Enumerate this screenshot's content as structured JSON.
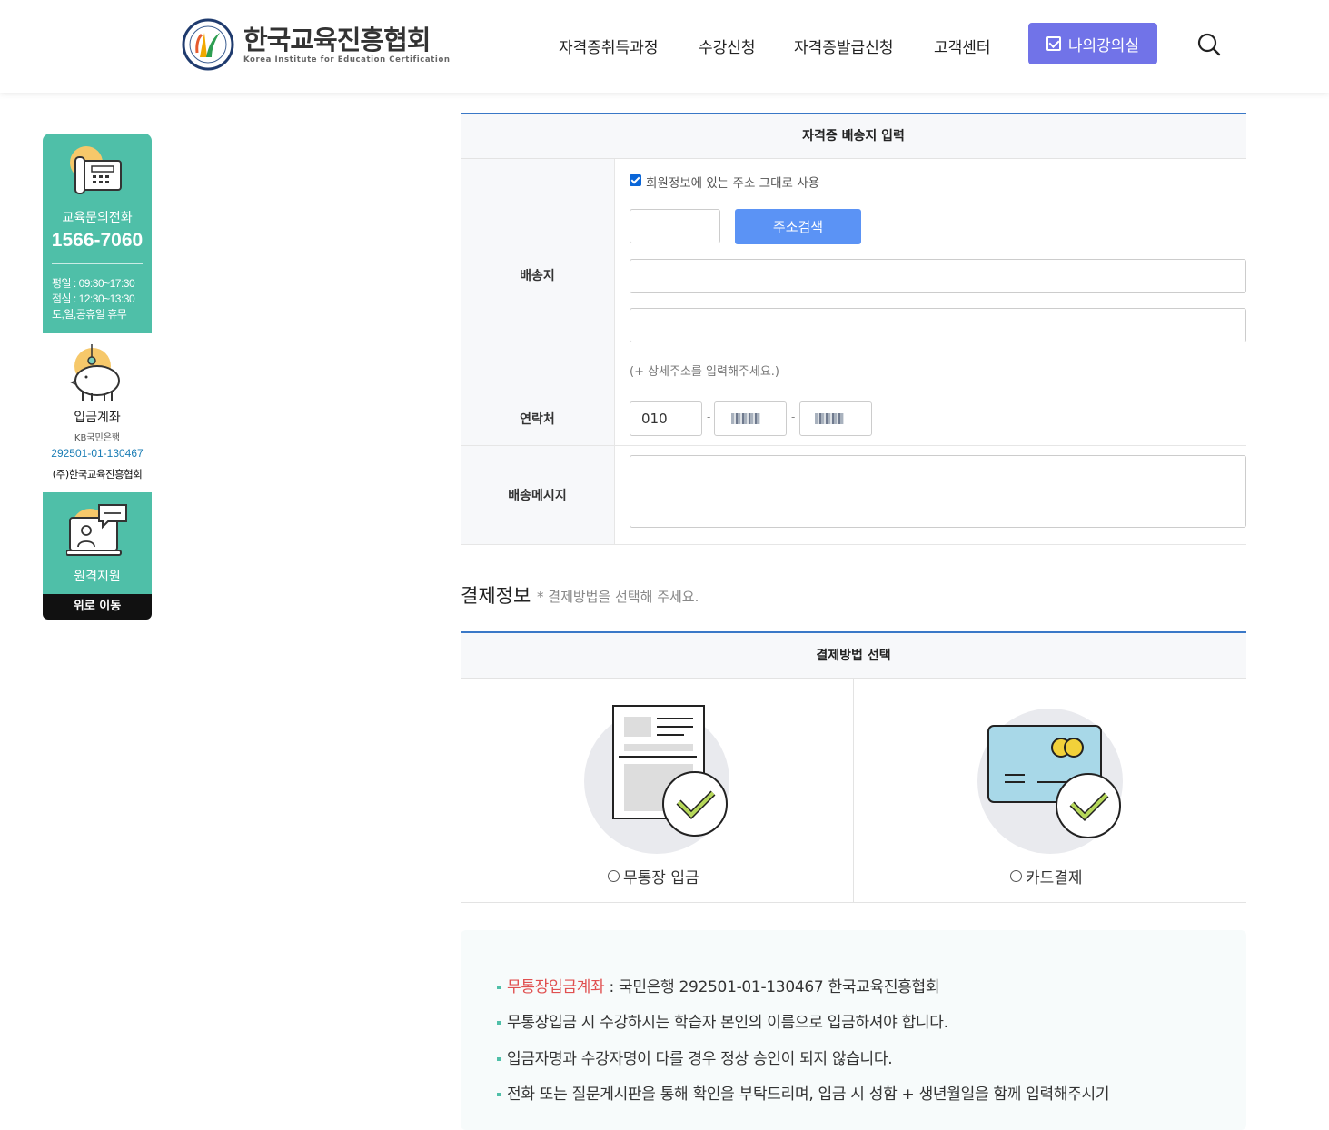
{
  "header": {
    "logo_ko": "한국교육진흥협회",
    "logo_en": "Korea Institute for Education Certification",
    "nav": [
      "자격증취득과정",
      "수강신청",
      "자격증발급신청",
      "고객센터"
    ],
    "lecture_btn": "나의강의실"
  },
  "sidebar": {
    "call_title": "교육문의전화",
    "call_number": "1566-7060",
    "hours": [
      "평일 : 09:30~17:30",
      "점심 : 12:30~13:30",
      "토,일,공휴일 휴무"
    ],
    "bank_title": "입금계좌",
    "bank_name": "KB국민은행",
    "bank_account": "292501-01-130467",
    "bank_holder": "(주)한국교육진흥협회",
    "remote": "원격지원",
    "top": "위로 이동"
  },
  "shipping": {
    "title": "자격증 배송지 입력",
    "address_label": "배송지",
    "use_member_addr": "회원정보에 있는 주소 그대로 사용",
    "search_btn": "주소검색",
    "hint": "(+ 상세주소를 입력해주세요.)",
    "phone_label": "연락처",
    "phone_prefix": "010",
    "message_label": "배송메시지"
  },
  "payment": {
    "heading": "결제정보",
    "subheading": "* 결제방법을 선택해 주세요.",
    "title": "결제방법 선택",
    "options": [
      "무통장 입금",
      "카드결제"
    ]
  },
  "notice": {
    "line1_label": "무통장입금계좌",
    "line1_text": " : 국민은행 292501-01-130467 한국교육진흥협회",
    "line2": "무통장입금 시 수강하시는 학습자 본인의 이름으로 입금하셔야 합니다.",
    "line3": "입금자명과 수강자명이 다를 경우 정상 승인이 되지 않습니다.",
    "line4": "전화 또는 질문게시판을 통해 확인을 부탁드리며, 입금 시 성함 + 생년월일을 함께 입력해주시기"
  }
}
